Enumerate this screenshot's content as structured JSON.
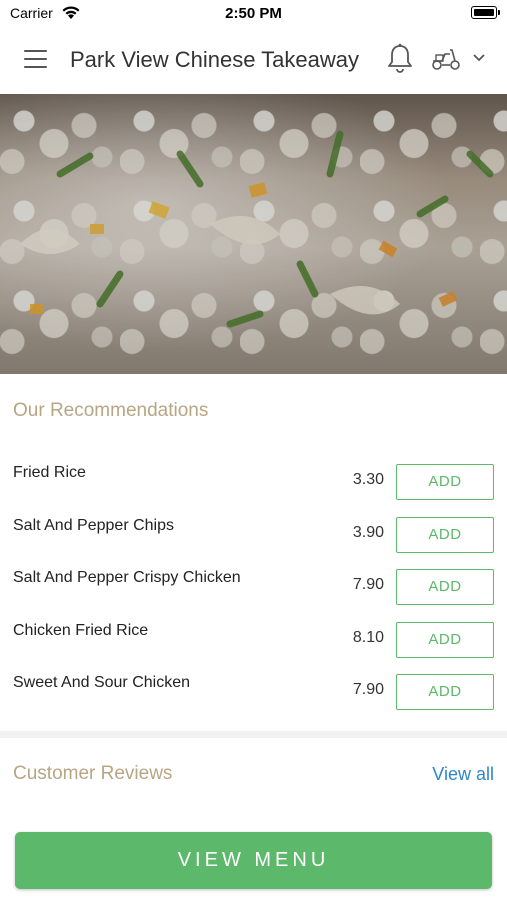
{
  "status_bar": {
    "carrier": "Carrier",
    "time": "2:50 PM"
  },
  "header": {
    "title": "Park View Chinese Takeaway",
    "icons": [
      "menu-icon",
      "bell-icon",
      "scooter-icon",
      "chevron-down-icon"
    ]
  },
  "recommendations": {
    "title": "Our Recommendations",
    "items": [
      {
        "name": "Fried Rice",
        "price": "3.30",
        "button": "ADD"
      },
      {
        "name": "Salt And Pepper Chips",
        "price": "3.90",
        "button": "ADD"
      },
      {
        "name": "Salt And Pepper Crispy Chicken",
        "price": "7.90",
        "button": "ADD"
      },
      {
        "name": "Chicken Fried Rice",
        "price": "8.10",
        "button": "ADD"
      },
      {
        "name": "Sweet And Sour Chicken",
        "price": "7.90",
        "button": "ADD"
      }
    ]
  },
  "reviews": {
    "title": "Customer Reviews",
    "view_all": "View all"
  },
  "footer": {
    "view_menu": "VIEW MENU"
  },
  "colors": {
    "accent_green": "#5cb86a",
    "section_title": "#b8a584",
    "link_blue": "#2f86c8"
  }
}
